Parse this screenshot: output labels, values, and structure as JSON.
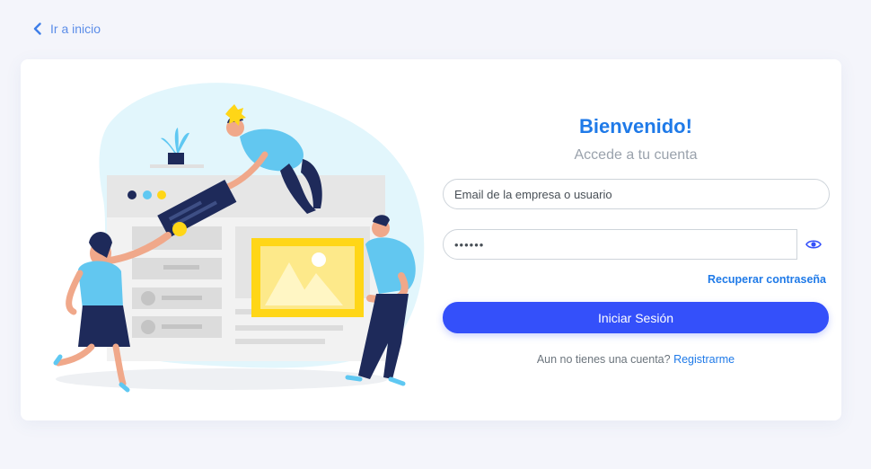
{
  "nav": {
    "back_label": "Ir a inicio"
  },
  "login": {
    "title": "Bienvenido!",
    "subtitle": "Accede a tu cuenta",
    "email_placeholder": "Email de la empresa o usuario",
    "password_value": "••••••",
    "recover_label": "Recuperar contraseña",
    "submit_label": "Iniciar Sesión",
    "register_prompt": "Aun no tienes una cuenta?",
    "register_link": "Registrarme"
  },
  "icons": {
    "back": "chevron-left-icon",
    "toggle_password": "eye-icon"
  },
  "colors": {
    "accent": "#1f7ae8",
    "primary_button": "#3450fa",
    "background": "#f4f5fb",
    "illustration_blob": "#e2f6fc",
    "illustration_yellow": "#ffd617",
    "illustration_navy": "#1e2a5a"
  }
}
